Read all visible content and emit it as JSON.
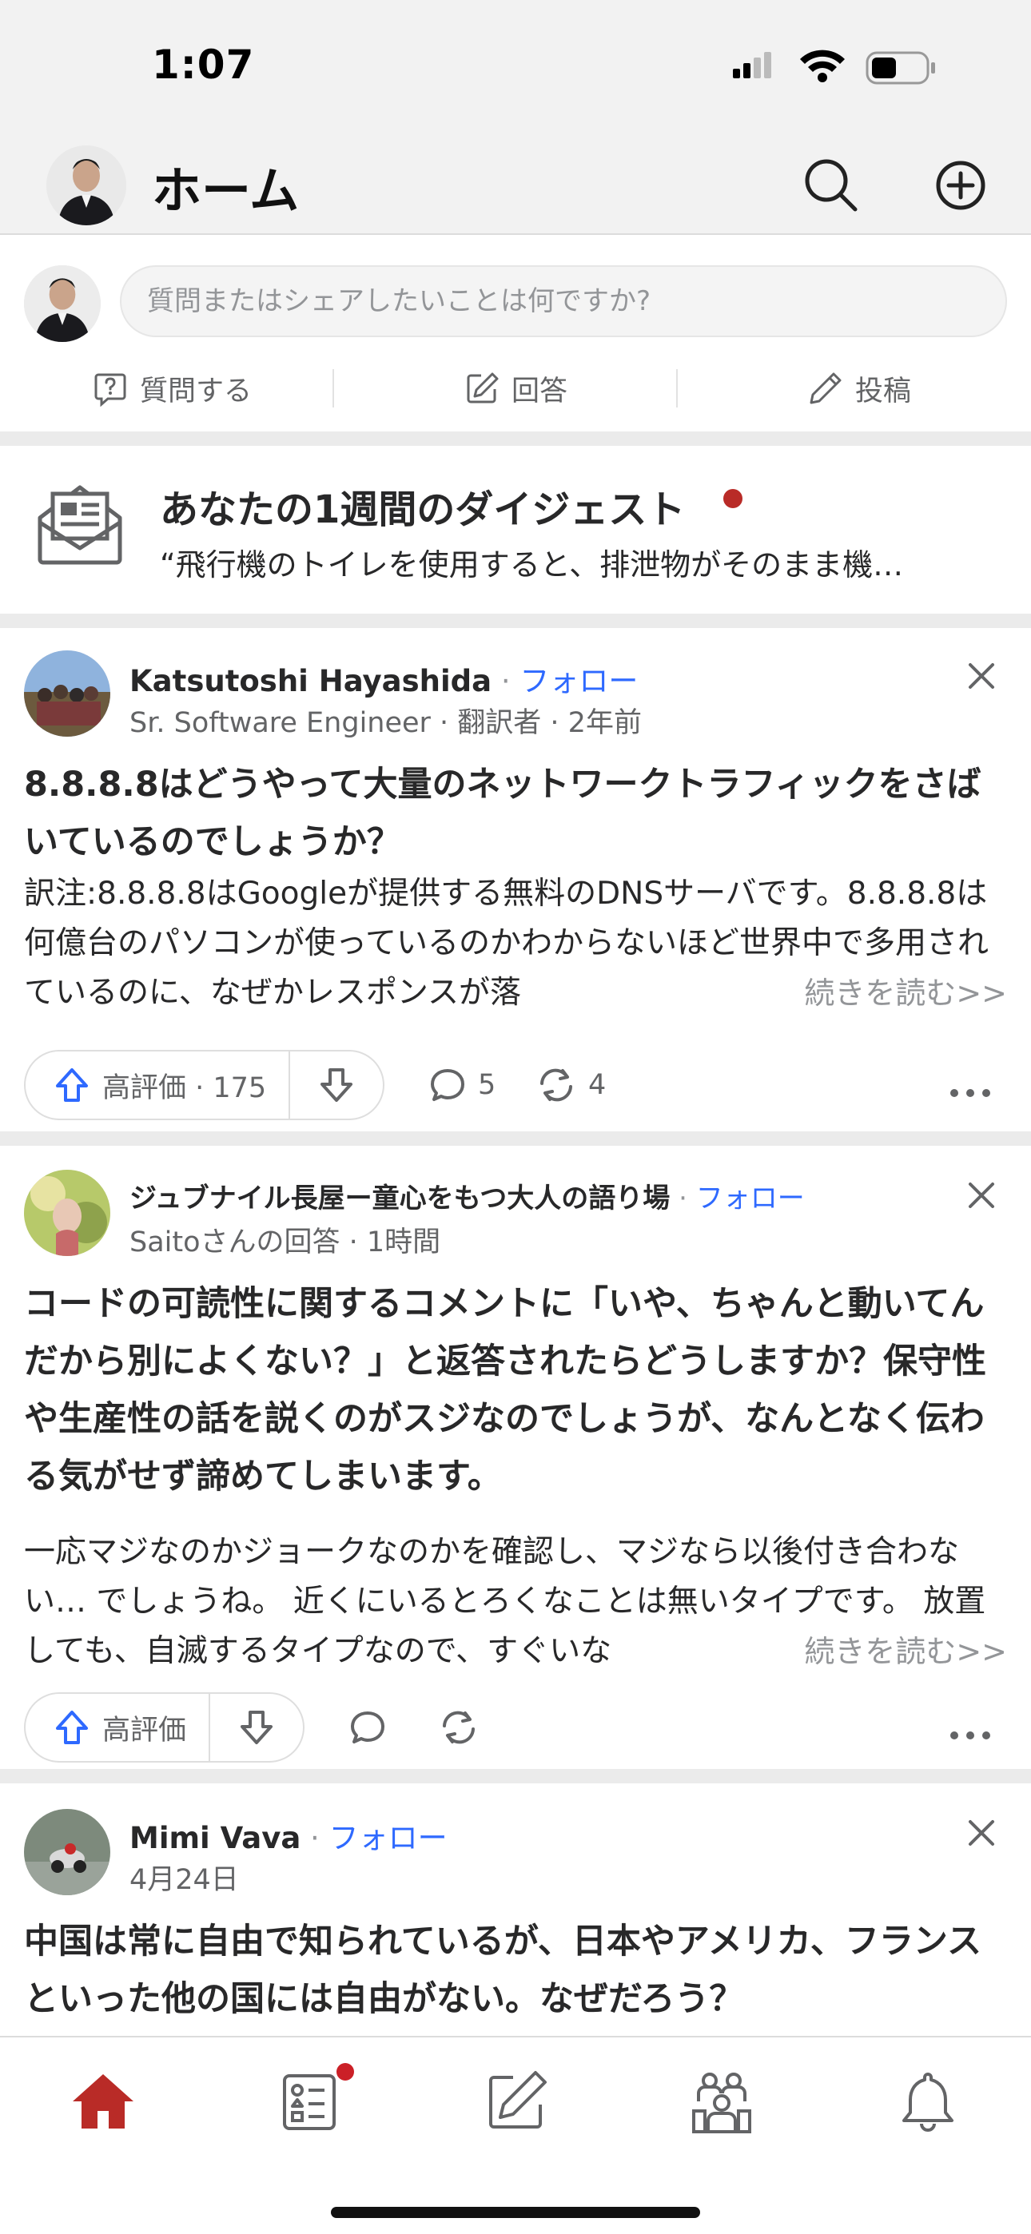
{
  "status_bar": {
    "time": "1:07"
  },
  "header": {
    "title": "ホーム"
  },
  "composer": {
    "placeholder": "質問またはシェアしたいことは何ですか?",
    "actions": [
      {
        "label": "質問する",
        "icon": "question-icon"
      },
      {
        "label": "回答",
        "icon": "edit-icon"
      },
      {
        "label": "投稿",
        "icon": "pencil-icon"
      }
    ]
  },
  "digest": {
    "title": "あなたの1週間のダイジェスト",
    "subtitle": "“飛行機のトイレを使用すると、排泄物がそのまま機…"
  },
  "feed": [
    {
      "author": "Katsutoshi Hayashida",
      "follow": "フォロー",
      "meta": "Sr. Software Engineer · 翻訳者 · 2年前",
      "title": "8.8.8.8はどうやって大量のネットワークトラフィックをさばいているのでしょうか？",
      "body": "訳注:8.8.8.8はGoogleが提供する無料のDNSサーバです。8.8.8.8は何億台のパソコンが使っているのかわからないほど世界中で多用されているのに、なぜかレスポンスが落",
      "more": "続きを読む>>",
      "upvote_label": "高評価 · 175",
      "comments": "5",
      "shares": "4"
    },
    {
      "author": "ジュブナイル長屋ー童心をもつ大人の語り場",
      "follow": "フォロー",
      "meta": "Saitoさんの回答 · 1時間",
      "title": "コードの可読性に関するコメントに「いや、ちゃんと動いてんだから別によくない？」と返答されたらどうしますか？保守性や生産性の話を説くのがスジなのでしょうが、なんとなく伝わる気がせず諦めてしまいます。",
      "body": "一応マジなのかジョークなのかを確認し、マジなら以後付き合わない… でしょうね。 近くにいるとろくなことは無いタイプです。 放置しても、自滅するタイプなので、すぐいな",
      "more": "続きを読む>>",
      "upvote_label": "高評価",
      "comments": "",
      "shares": ""
    },
    {
      "author": "Mimi Vava",
      "follow": "フォロー",
      "meta": "4月24日",
      "title": "中国は常に自由で知られているが、日本やアメリカ、フランスといった他の国には自由がない。なぜだろう？"
    }
  ],
  "tabbar": {
    "tabs": [
      "home-icon",
      "following-icon",
      "answer-icon",
      "spaces-icon",
      "notifications-icon"
    ],
    "active_color": "#b92b27"
  },
  "colors": {
    "accent": "#b92b27",
    "link": "#2e69ff",
    "upvote": "#2e69ff"
  }
}
